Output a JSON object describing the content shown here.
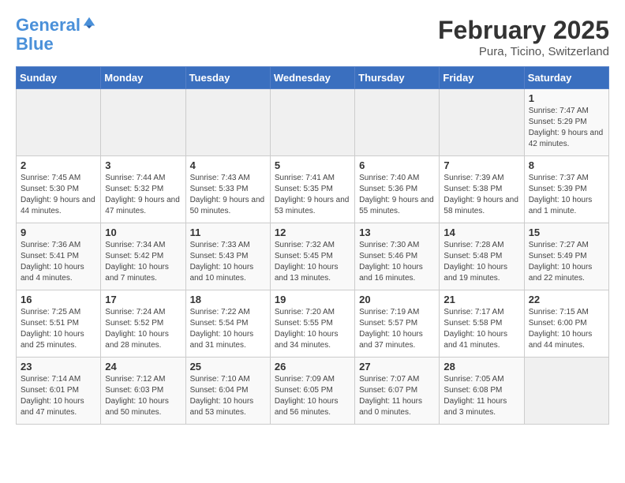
{
  "header": {
    "logo_line1": "General",
    "logo_line2": "Blue",
    "month": "February 2025",
    "location": "Pura, Ticino, Switzerland"
  },
  "weekdays": [
    "Sunday",
    "Monday",
    "Tuesday",
    "Wednesday",
    "Thursday",
    "Friday",
    "Saturday"
  ],
  "weeks": [
    [
      {
        "day": "",
        "detail": ""
      },
      {
        "day": "",
        "detail": ""
      },
      {
        "day": "",
        "detail": ""
      },
      {
        "day": "",
        "detail": ""
      },
      {
        "day": "",
        "detail": ""
      },
      {
        "day": "",
        "detail": ""
      },
      {
        "day": "1",
        "detail": "Sunrise: 7:47 AM\nSunset: 5:29 PM\nDaylight: 9 hours and 42 minutes."
      }
    ],
    [
      {
        "day": "2",
        "detail": "Sunrise: 7:45 AM\nSunset: 5:30 PM\nDaylight: 9 hours and 44 minutes."
      },
      {
        "day": "3",
        "detail": "Sunrise: 7:44 AM\nSunset: 5:32 PM\nDaylight: 9 hours and 47 minutes."
      },
      {
        "day": "4",
        "detail": "Sunrise: 7:43 AM\nSunset: 5:33 PM\nDaylight: 9 hours and 50 minutes."
      },
      {
        "day": "5",
        "detail": "Sunrise: 7:41 AM\nSunset: 5:35 PM\nDaylight: 9 hours and 53 minutes."
      },
      {
        "day": "6",
        "detail": "Sunrise: 7:40 AM\nSunset: 5:36 PM\nDaylight: 9 hours and 55 minutes."
      },
      {
        "day": "7",
        "detail": "Sunrise: 7:39 AM\nSunset: 5:38 PM\nDaylight: 9 hours and 58 minutes."
      },
      {
        "day": "8",
        "detail": "Sunrise: 7:37 AM\nSunset: 5:39 PM\nDaylight: 10 hours and 1 minute."
      }
    ],
    [
      {
        "day": "9",
        "detail": "Sunrise: 7:36 AM\nSunset: 5:41 PM\nDaylight: 10 hours and 4 minutes."
      },
      {
        "day": "10",
        "detail": "Sunrise: 7:34 AM\nSunset: 5:42 PM\nDaylight: 10 hours and 7 minutes."
      },
      {
        "day": "11",
        "detail": "Sunrise: 7:33 AM\nSunset: 5:43 PM\nDaylight: 10 hours and 10 minutes."
      },
      {
        "day": "12",
        "detail": "Sunrise: 7:32 AM\nSunset: 5:45 PM\nDaylight: 10 hours and 13 minutes."
      },
      {
        "day": "13",
        "detail": "Sunrise: 7:30 AM\nSunset: 5:46 PM\nDaylight: 10 hours and 16 minutes."
      },
      {
        "day": "14",
        "detail": "Sunrise: 7:28 AM\nSunset: 5:48 PM\nDaylight: 10 hours and 19 minutes."
      },
      {
        "day": "15",
        "detail": "Sunrise: 7:27 AM\nSunset: 5:49 PM\nDaylight: 10 hours and 22 minutes."
      }
    ],
    [
      {
        "day": "16",
        "detail": "Sunrise: 7:25 AM\nSunset: 5:51 PM\nDaylight: 10 hours and 25 minutes."
      },
      {
        "day": "17",
        "detail": "Sunrise: 7:24 AM\nSunset: 5:52 PM\nDaylight: 10 hours and 28 minutes."
      },
      {
        "day": "18",
        "detail": "Sunrise: 7:22 AM\nSunset: 5:54 PM\nDaylight: 10 hours and 31 minutes."
      },
      {
        "day": "19",
        "detail": "Sunrise: 7:20 AM\nSunset: 5:55 PM\nDaylight: 10 hours and 34 minutes."
      },
      {
        "day": "20",
        "detail": "Sunrise: 7:19 AM\nSunset: 5:57 PM\nDaylight: 10 hours and 37 minutes."
      },
      {
        "day": "21",
        "detail": "Sunrise: 7:17 AM\nSunset: 5:58 PM\nDaylight: 10 hours and 41 minutes."
      },
      {
        "day": "22",
        "detail": "Sunrise: 7:15 AM\nSunset: 6:00 PM\nDaylight: 10 hours and 44 minutes."
      }
    ],
    [
      {
        "day": "23",
        "detail": "Sunrise: 7:14 AM\nSunset: 6:01 PM\nDaylight: 10 hours and 47 minutes."
      },
      {
        "day": "24",
        "detail": "Sunrise: 7:12 AM\nSunset: 6:03 PM\nDaylight: 10 hours and 50 minutes."
      },
      {
        "day": "25",
        "detail": "Sunrise: 7:10 AM\nSunset: 6:04 PM\nDaylight: 10 hours and 53 minutes."
      },
      {
        "day": "26",
        "detail": "Sunrise: 7:09 AM\nSunset: 6:05 PM\nDaylight: 10 hours and 56 minutes."
      },
      {
        "day": "27",
        "detail": "Sunrise: 7:07 AM\nSunset: 6:07 PM\nDaylight: 11 hours and 0 minutes."
      },
      {
        "day": "28",
        "detail": "Sunrise: 7:05 AM\nSunset: 6:08 PM\nDaylight: 11 hours and 3 minutes."
      },
      {
        "day": "",
        "detail": ""
      }
    ]
  ]
}
